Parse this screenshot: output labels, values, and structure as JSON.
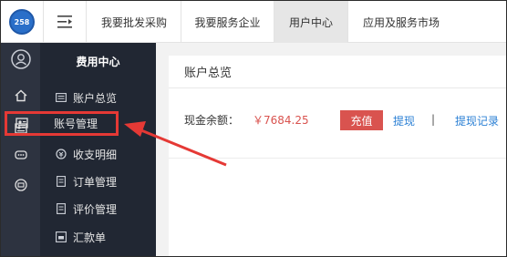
{
  "header": {
    "logo_text": "258",
    "tabs": [
      {
        "label": "我要批发采购"
      },
      {
        "label": "我要服务企业"
      },
      {
        "label": "用户中心"
      },
      {
        "label": "应用及服务市场"
      }
    ]
  },
  "sidebar": {
    "title": "费用中心",
    "items": [
      {
        "label": "账户总览",
        "icon": "list-icon"
      },
      {
        "label": "账号管理",
        "icon": "id-card-icon"
      },
      {
        "label": "收支明细",
        "icon": "money-icon"
      },
      {
        "label": "订单管理",
        "icon": "order-icon"
      },
      {
        "label": "评价管理",
        "icon": "comment-icon"
      },
      {
        "label": "汇款单",
        "icon": "remit-icon"
      }
    ]
  },
  "iconbar": [
    "user-icon",
    "home-icon",
    "id-card-icon",
    "chat-icon",
    "shop-icon"
  ],
  "main": {
    "title": "账户总览",
    "balance_label": "现金余额：",
    "balance_value": "￥7684.25",
    "recharge_label": "充值",
    "withdraw_label": "提现",
    "separator": "|",
    "withdraw_record_label": "提现记录"
  },
  "colors": {
    "accent_red": "#d9534f",
    "link_blue": "#2a7fd4",
    "sidebar_bg": "#212733",
    "highlight": "#e53935"
  }
}
